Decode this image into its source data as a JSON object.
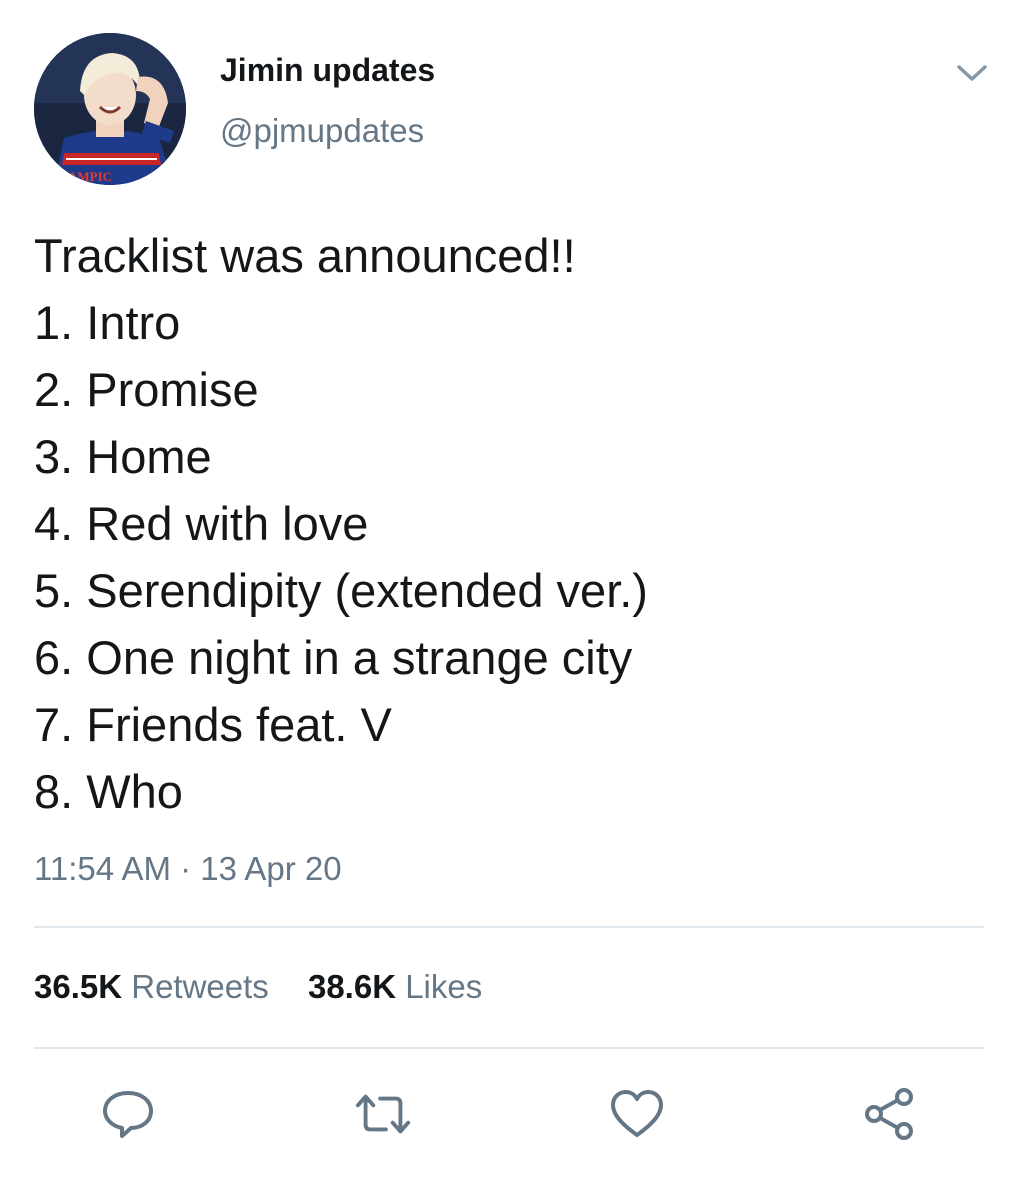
{
  "user": {
    "display_name": "Jimin updates",
    "handle": "@pjmupdates"
  },
  "tweet": {
    "lines": [
      "Tracklist was announced!!",
      "1. Intro",
      "2. Promise",
      "3. Home",
      "4. Red with love",
      "5. Serendipity (extended ver.)",
      "6. One night in a strange city",
      "7. Friends feat. V",
      "8. Who"
    ],
    "timestamp": "11:54 AM · 13 Apr 20"
  },
  "stats": {
    "retweets_count": "36.5K",
    "retweets_label": "Retweets",
    "likes_count": "38.6K",
    "likes_label": "Likes"
  },
  "actions": {
    "reply_icon": "reply-icon",
    "retweet_icon": "retweet-icon",
    "like_icon": "heart-icon",
    "share_icon": "share-icon"
  },
  "colors": {
    "text_primary": "#14171a",
    "text_secondary": "#657786",
    "divider": "#e1e8ed"
  }
}
